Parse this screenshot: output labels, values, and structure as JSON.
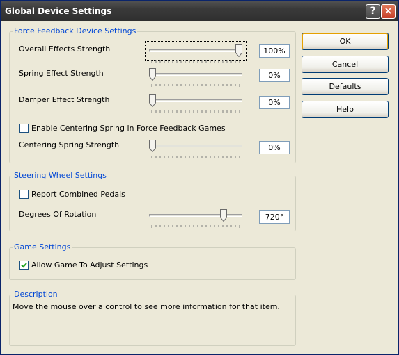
{
  "window": {
    "title": "Global Device Settings",
    "help_glyph": "?",
    "close_glyph": "×"
  },
  "force_feedback": {
    "title": "Force Feedback Device Settings",
    "overall": {
      "label": "Overall Effects Strength",
      "value": "100%",
      "level": 1.0
    },
    "spring": {
      "label": "Spring Effect Strength",
      "value": "0%",
      "level": 0
    },
    "damper": {
      "label": "Damper Effect Strength",
      "value": "0%",
      "level": 0
    },
    "enable_centering": {
      "label": "Enable Centering Spring in Force Feedback Games",
      "checked": false
    },
    "centering": {
      "label": "Centering Spring Strength",
      "value": "0%",
      "level": 0
    }
  },
  "steering": {
    "title": "Steering Wheel Settings",
    "report_combined": {
      "label": "Report Combined Pedals",
      "checked": false
    },
    "rotation": {
      "label": "Degrees Of Rotation",
      "value": "720°",
      "level": 0.82
    }
  },
  "game": {
    "title": "Game Settings",
    "allow_adjust": {
      "label": "Allow Game To Adjust Settings",
      "checked": true
    }
  },
  "description": {
    "title": "Description",
    "text": "Move the mouse over a control to see more information for that item."
  },
  "buttons": {
    "ok": "OK",
    "cancel": "Cancel",
    "defaults": "Defaults",
    "help": "Help"
  }
}
